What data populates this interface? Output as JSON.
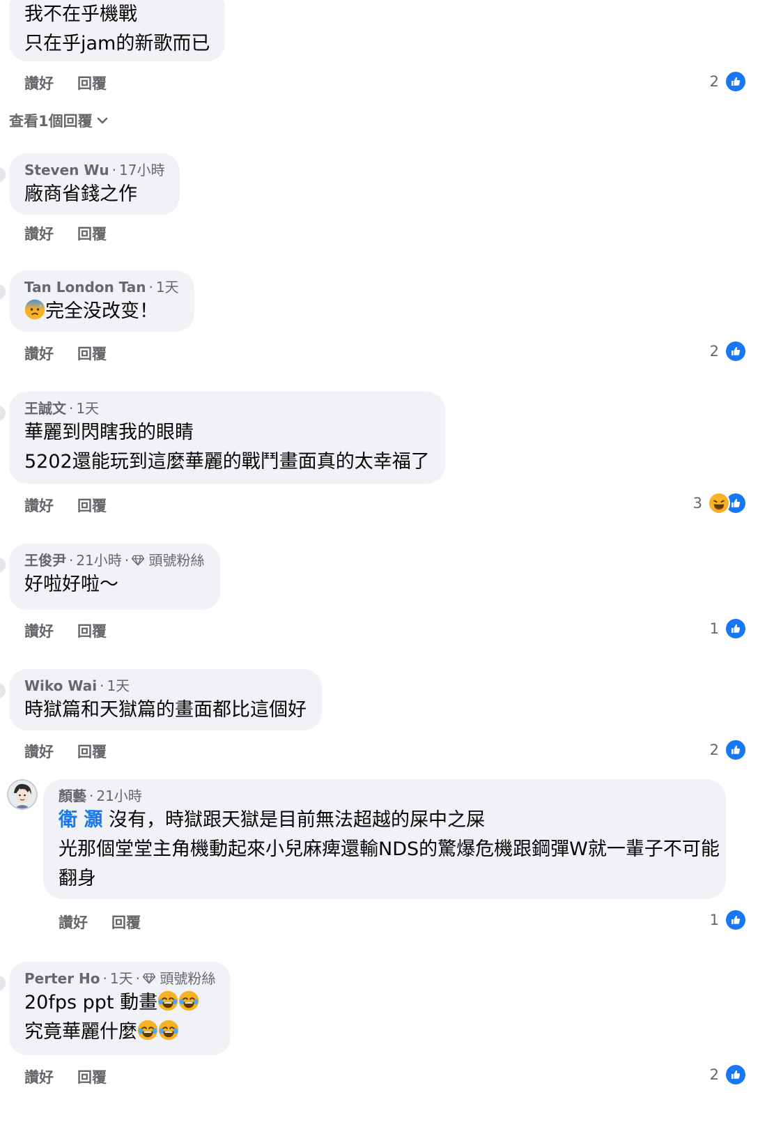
{
  "actions": {
    "like": "讚好",
    "reply": "回覆"
  },
  "comment0": {
    "lines": [
      "我不在乎機戰",
      "只在乎jam的新歌而已"
    ],
    "count": "2"
  },
  "view_replies": "查看1個回覆",
  "comment1": {
    "author": "Steven Wu",
    "time": "17小時",
    "text": "廠商省錢之作"
  },
  "comment2": {
    "author": "Tan London Tan",
    "time": "1天",
    "text": "完全没改变！",
    "count": "2"
  },
  "comment3": {
    "author": "王誠文",
    "time": "1天",
    "lines": [
      "華麗到閃瞎我的眼睛",
      "5202還能玩到這麼華麗的戰鬥畫面真的太幸福了"
    ],
    "count": "3"
  },
  "comment4": {
    "author": "王俊尹",
    "time": "21小時",
    "badge": "頭號粉絲",
    "text": "好啦好啦～",
    "count": "1"
  },
  "comment5": {
    "author": "Wiko Wai",
    "time": "1天",
    "text": "時獄篇和天獄篇的畫面都比這個好",
    "count": "2"
  },
  "reply1": {
    "author": "顏藝",
    "time": "21小時",
    "mention": "衛 灝",
    "line1": "沒有，時獄跟天獄是目前無法超越的屎中之屎",
    "line2": "光那個堂堂主角機動起來小兒麻痺還輸NDS的驚爆危機跟鋼彈W就一輩子不可能",
    "line3": "翻身",
    "count": "1"
  },
  "comment6": {
    "author": "Perter Ho",
    "time": "1天",
    "badge": "頭號粉絲",
    "line1": "20fps ppt 動畫",
    "line2": "究竟華麗什麼",
    "count": "2"
  },
  "colors": {
    "like_blue": "#1877f2",
    "bubble": "#f0f2f5",
    "meta": "#65676b",
    "haha": "#f7b125"
  }
}
